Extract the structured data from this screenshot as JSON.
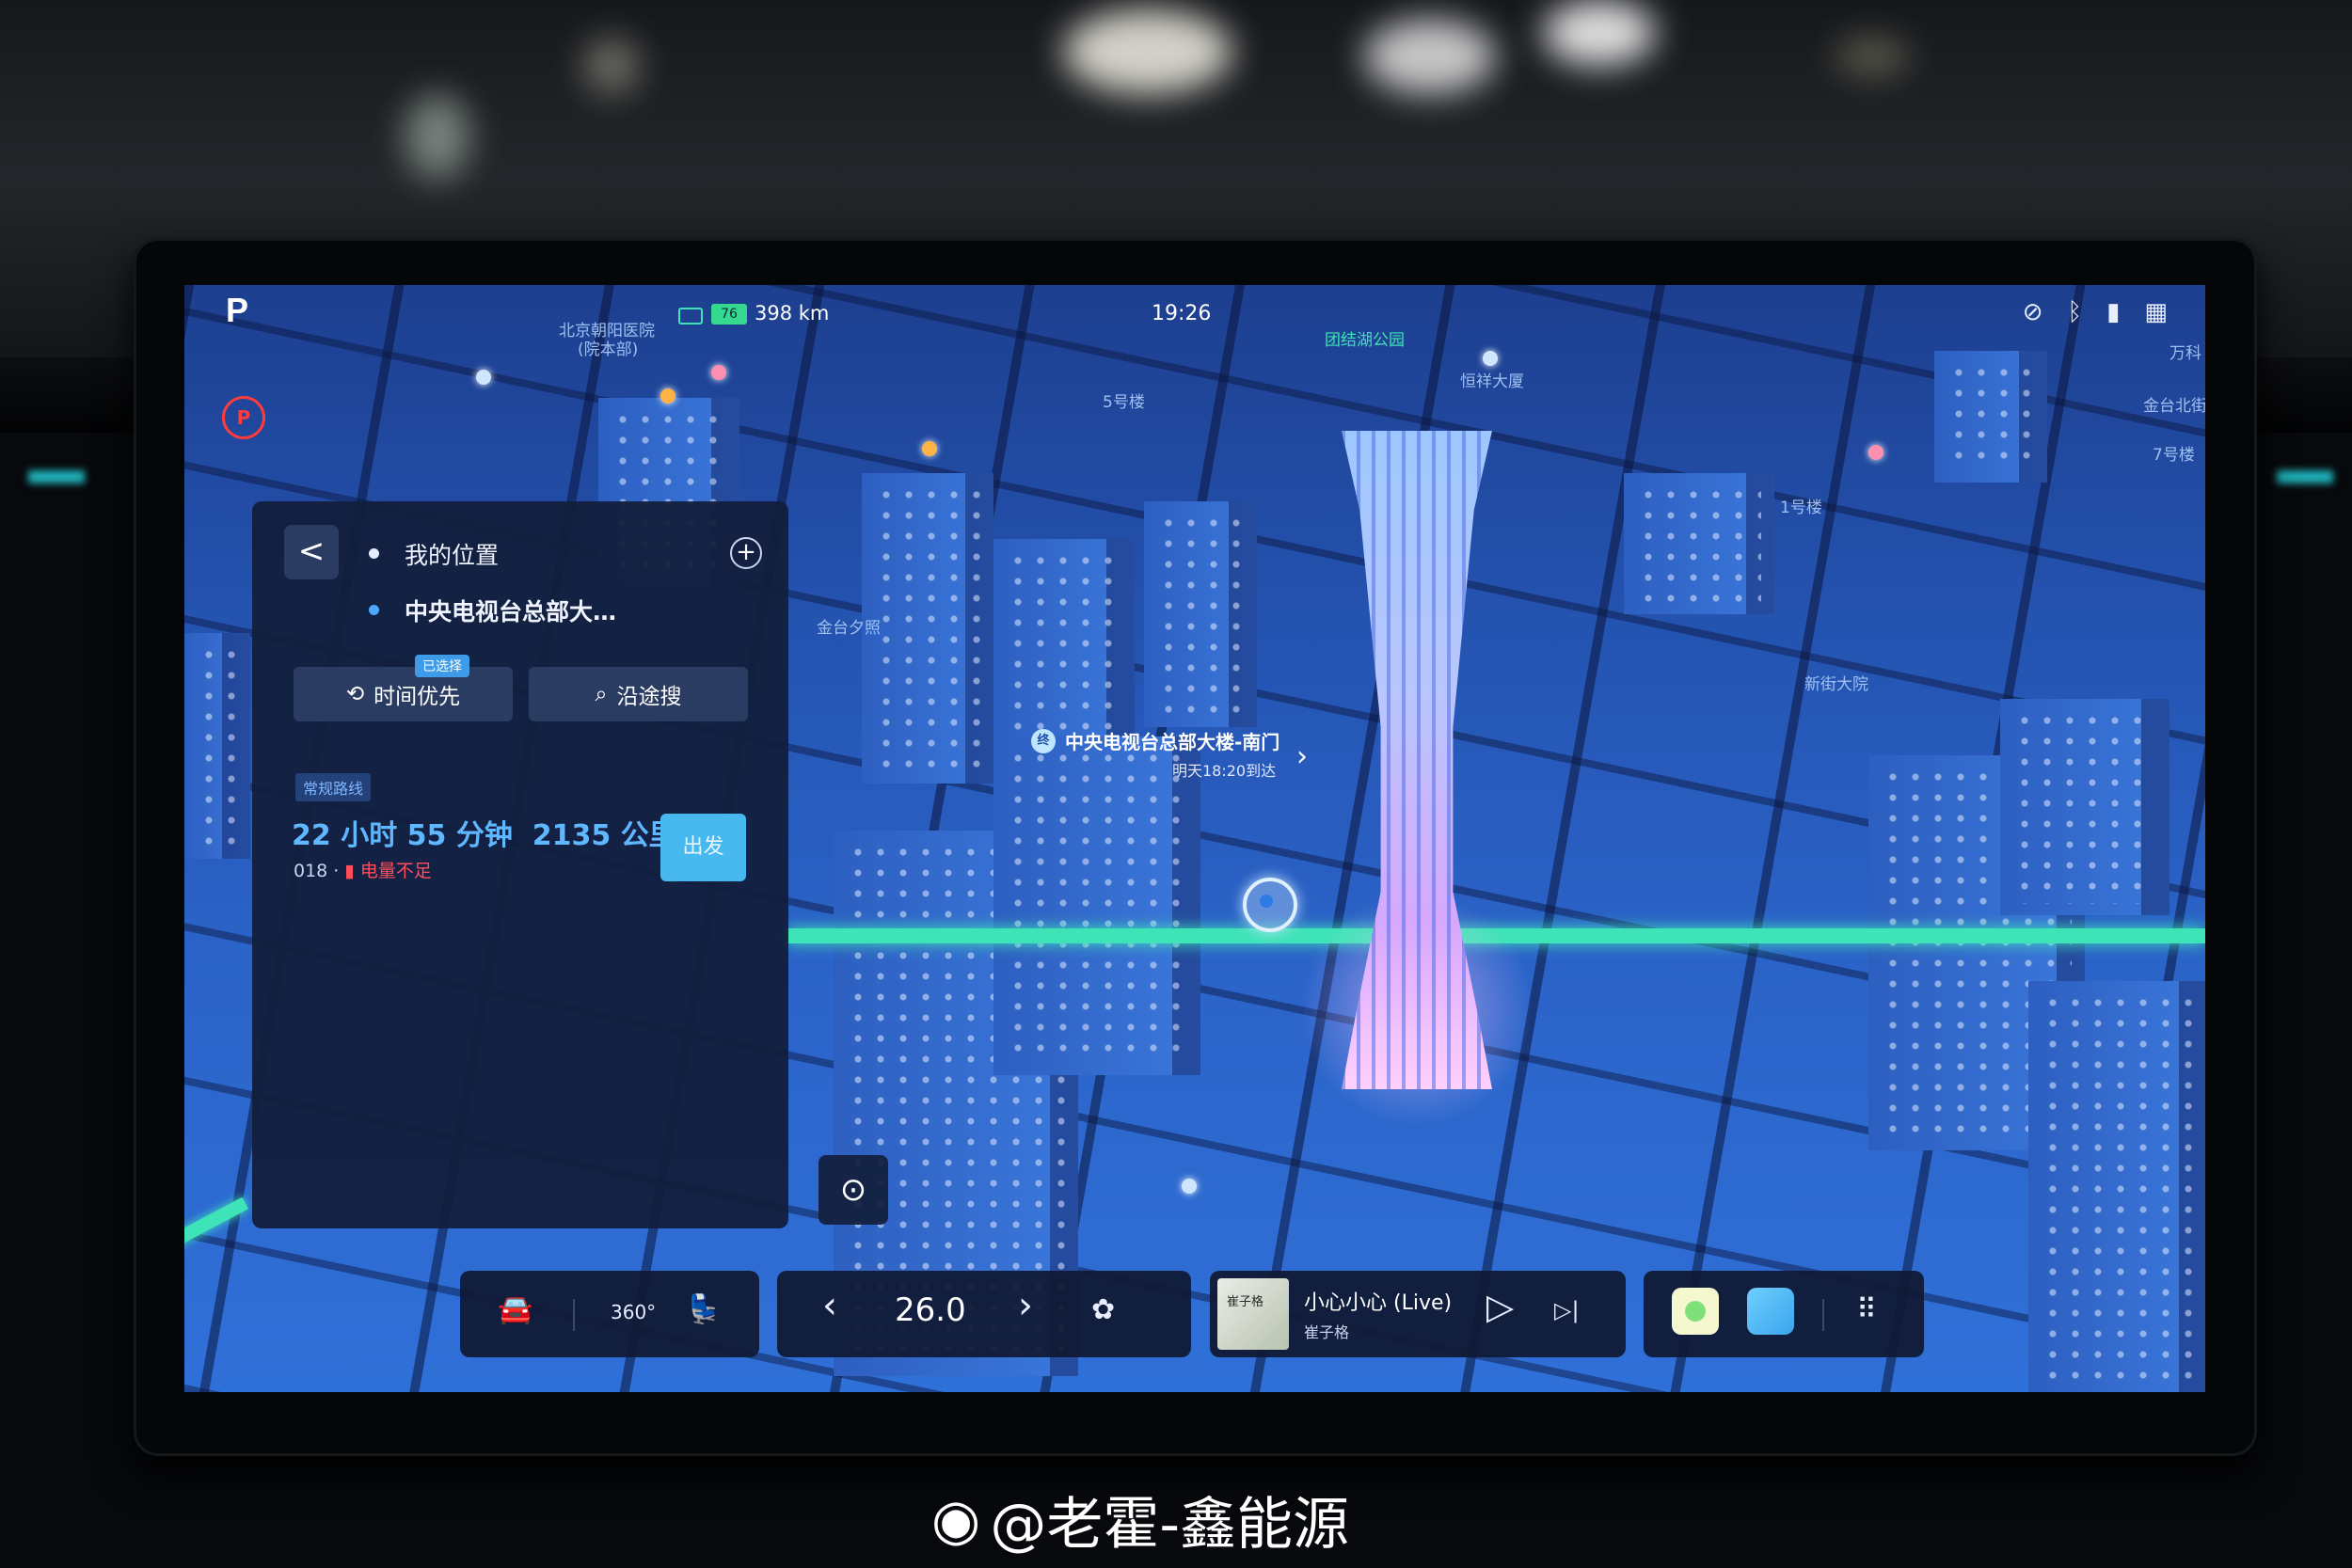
{
  "status_bar": {
    "gear": "P",
    "battery_percent": "76",
    "range": "398 km",
    "time": "19:26",
    "icons": [
      "camera-off-icon",
      "bluetooth-icon",
      "signal-icon",
      "layout-icon"
    ],
    "parking_brake_symbol": "P"
  },
  "map": {
    "labels": [
      "北京朝阳医院",
      "(院本部)",
      "团结湖公园",
      "恒祥大厦",
      "金台夕照",
      "新街大院",
      "1号楼",
      "7号楼",
      "万科",
      "金台北街",
      "5号楼"
    ],
    "destination_label": "中央电视台总部大楼-南门",
    "destination_eta": "明天18:20到达",
    "destination_badge": "终",
    "route_color": "#3fe3b8"
  },
  "route_panel": {
    "back_symbol": "<",
    "add_symbol": "+",
    "origin": "我的位置",
    "destination": "中央电视台总部大…",
    "option_time_first": "时间优先",
    "selected_tag": "已选择",
    "option_search_along": "沿途搜",
    "route_type_tag": "常规路线",
    "route_duration": "22 小时 55 分钟",
    "route_distance": "2135 公里",
    "charge_count": "018 ·",
    "battery_warning": "电量不足",
    "go_button": "出发"
  },
  "locate_button_symbol": "⊙",
  "dock": {
    "car_symbol": "🚘",
    "view_360": "360°",
    "seat_symbol": "💺",
    "temp_decrease": "‹",
    "temperature": "26.0",
    "temp_increase": "›",
    "fan_symbol": "✿",
    "song_title": "小心小心 (Live)",
    "artist": "崔子格",
    "album_label": "崔子格",
    "play_symbol": "▷",
    "next_symbol": "▷|",
    "apps_symbol": "⠿"
  },
  "watermark": "@老霍-鑫能源"
}
